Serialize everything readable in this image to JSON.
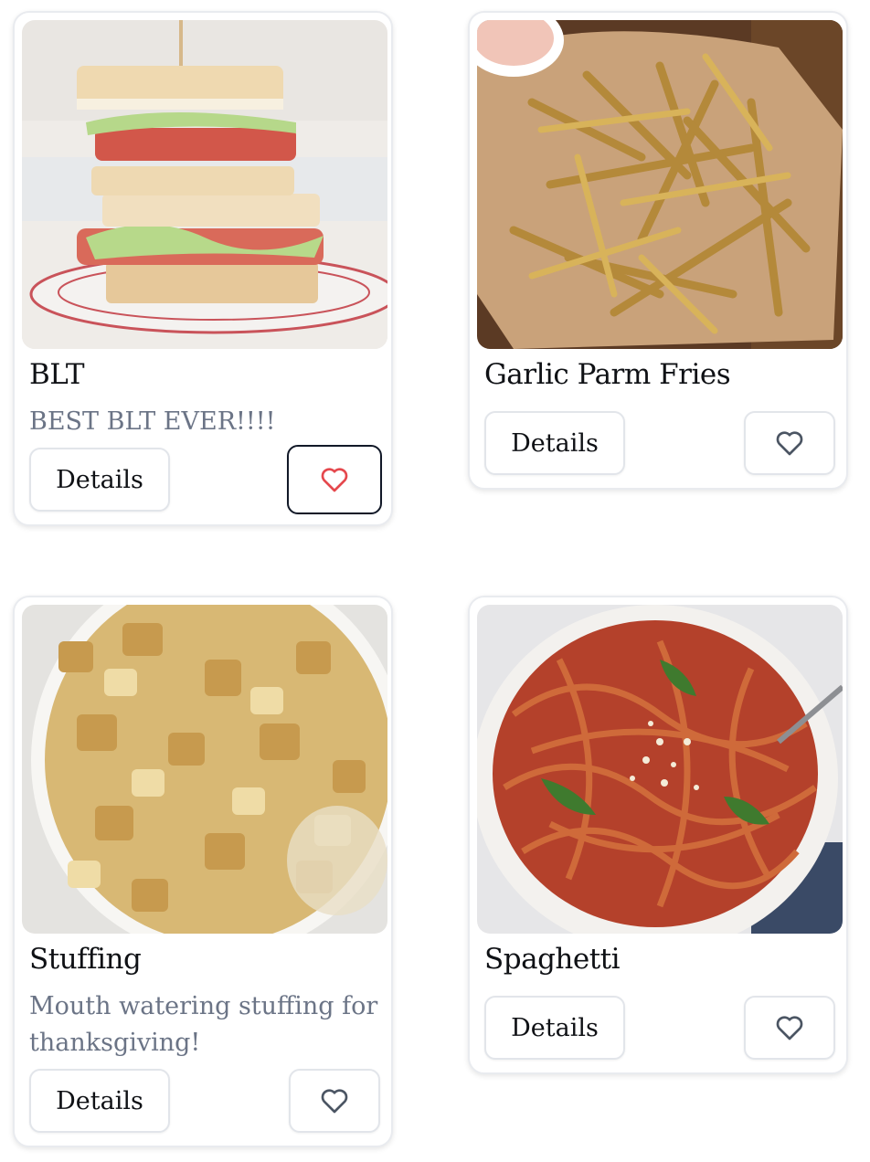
{
  "recipes": [
    {
      "title": "BLT",
      "description": "BEST BLT EVER!!!!",
      "details_label": "Details",
      "favorite_icon": "heart-icon",
      "favorite_color": "#e5484d",
      "favorited": true
    },
    {
      "title": "Garlic Parm Fries",
      "description": "",
      "details_label": "Details",
      "favorite_icon": "heart-icon",
      "favorite_color": "#4b5563",
      "favorited": false
    },
    {
      "title": "Stuffing",
      "description": "Mouth watering stuffing for thanksgiving!",
      "details_label": "Details",
      "favorite_icon": "heart-icon",
      "favorite_color": "#4b5563",
      "favorited": false
    },
    {
      "title": "Spaghetti",
      "description": "",
      "details_label": "Details",
      "favorite_icon": "heart-icon",
      "favorite_color": "#4b5563",
      "favorited": false
    }
  ]
}
